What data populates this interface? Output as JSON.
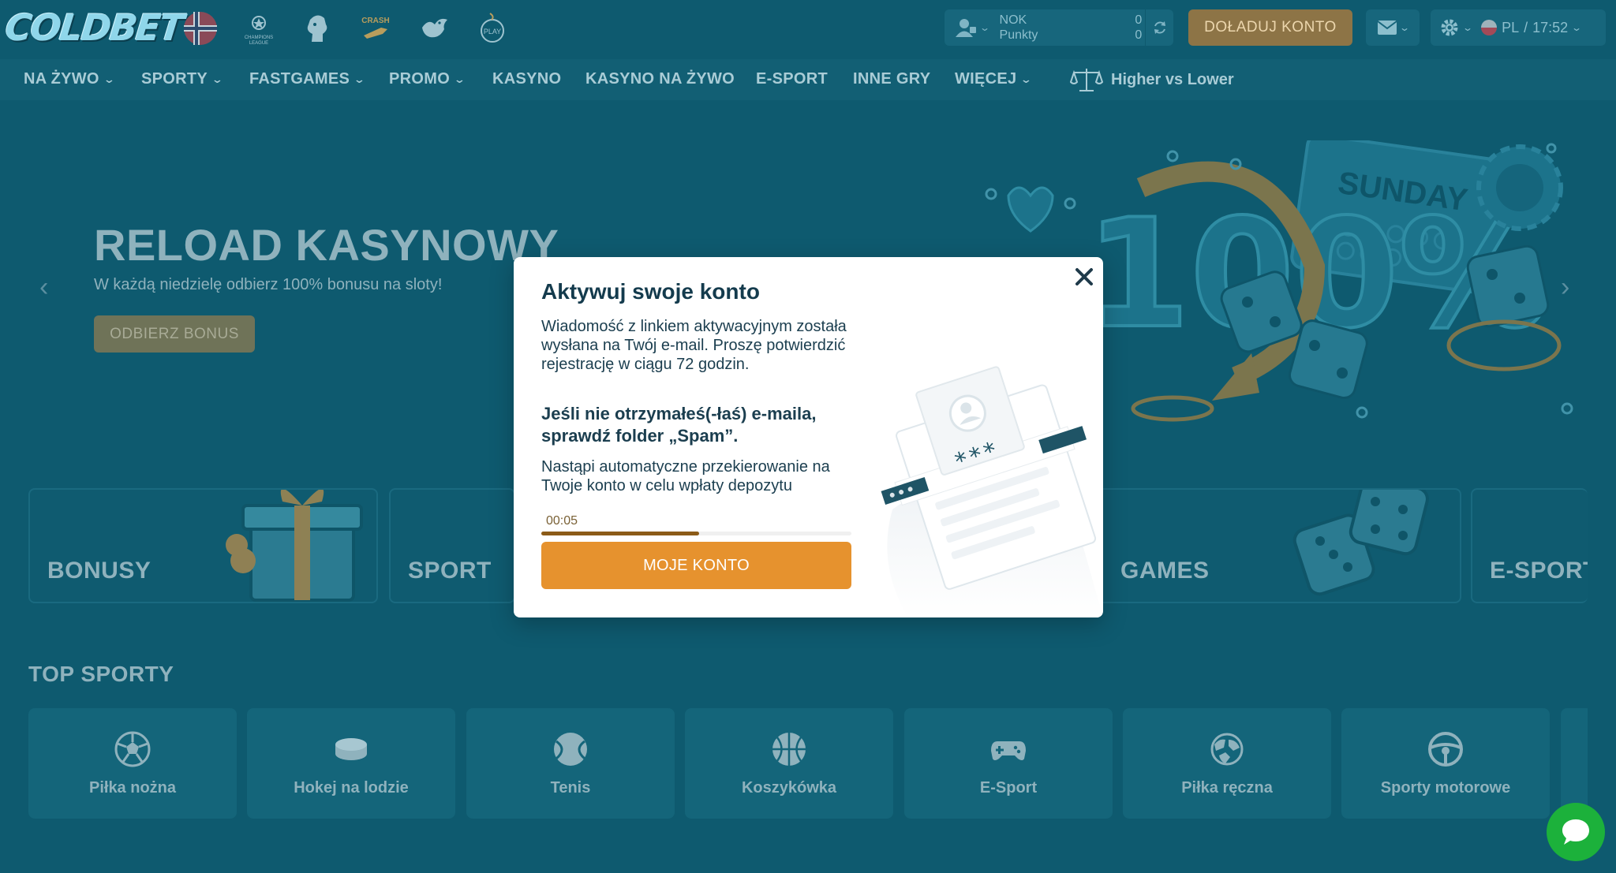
{
  "header": {
    "logo_text": "COLDBET",
    "quick_icons": [
      "norway-flag-icon",
      "champions-league-icon",
      "premier-league-icon",
      "crash-icon",
      "bird-game-icon",
      "play-icon"
    ],
    "account": {
      "currency_label": "NOK",
      "points_label": "Punkty",
      "balance": "0",
      "points": "0"
    },
    "deposit_label": "DOŁADUJ KONTO",
    "language": "PL",
    "time": "17:52"
  },
  "nav": {
    "items": [
      {
        "label": "NA ŻYWO",
        "dropdown": true
      },
      {
        "label": "SPORTY",
        "dropdown": true
      },
      {
        "label": "FASTGAMES",
        "dropdown": true
      },
      {
        "label": "PROMO",
        "dropdown": true
      },
      {
        "label": "KASYNO",
        "dropdown": false
      },
      {
        "label": "KASYNO NA ŻYWO",
        "dropdown": false
      },
      {
        "label": "E-SPORT",
        "dropdown": false
      },
      {
        "label": "INNE GRY",
        "dropdown": false
      },
      {
        "label": "WIĘCEJ",
        "dropdown": true
      }
    ],
    "featured": "Higher vs Lower"
  },
  "banner": {
    "title": "RELOAD KASYNOWY",
    "subtitle": "W każdą niedzielę odbierz 100% bonusu na sloty!",
    "button": "ODBIERZ BONUS",
    "art_day": "SUNDAY",
    "art_percent": "100%"
  },
  "categories": [
    {
      "label": "BONUSY"
    },
    {
      "label": "SPORT"
    },
    {
      "label": "GAMES"
    },
    {
      "label": "E-SPORT"
    }
  ],
  "top_sports": {
    "title": "TOP SPORTY",
    "items": [
      {
        "label": "Piłka nożna",
        "icon": "soccer-ball-icon"
      },
      {
        "label": "Hokej na lodzie",
        "icon": "hockey-puck-icon"
      },
      {
        "label": "Tenis",
        "icon": "tennis-ball-icon"
      },
      {
        "label": "Koszykówka",
        "icon": "basketball-icon"
      },
      {
        "label": "E-Sport",
        "icon": "gamepad-icon"
      },
      {
        "label": "Piłka ręczna",
        "icon": "handball-icon"
      },
      {
        "label": "Sporty motorowe",
        "icon": "steering-wheel-icon"
      }
    ]
  },
  "modal": {
    "title": "Aktywuj swoje konto",
    "message": "Wiadomość z linkiem aktywacyjnym została wysłana na Twój e-mail. Proszę potwierdzić rejestrację w ciągu 72 godzin.",
    "spam_hint": "Jeśli nie otrzymałeś(-łaś) e-maila, sprawdź folder „Spam”.",
    "redirect_note": "Nastąpi automatyczne przekierowanie na Twoje konto w celu wpłaty depozytu",
    "timer": "00:05",
    "timer_progress": 0.51,
    "button": "MOJE KONTO",
    "illustration_password": "***"
  },
  "colors": {
    "background": "#0e5a6f",
    "accent_orange": "#e6922e",
    "chat_green": "#1cb13b"
  }
}
